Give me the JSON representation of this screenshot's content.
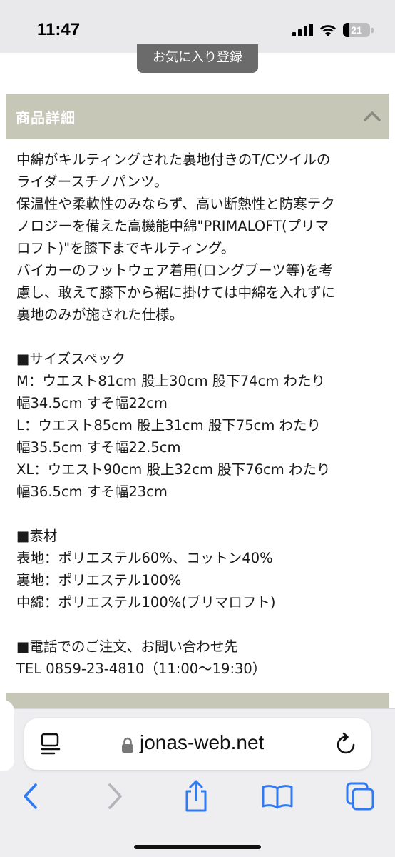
{
  "status": {
    "time": "11:47",
    "battery": "21",
    "icons": [
      "cellular-signal-icon",
      "wifi-icon",
      "battery-icon"
    ]
  },
  "favorite_button_label": "お気に入り登録",
  "section": {
    "title": "商品詳細",
    "icon": "chevron-up-icon"
  },
  "description": [
    "中綿がキルティングされた裏地付きのT/Cツイルの",
    "ライダースチノパンツ。",
    "保温性や柔軟性のみならず、高い断熱性と防寒テク",
    "ノロジーを備えた高機能中綿\"PRIMALOFT(プリマ",
    "ロフト)\"を膝下までキルティング。",
    "バイカーのフットウェア着用(ロングブーツ等)を考",
    "慮し、敢えて膝下から裾に掛けては中綿を入れずに",
    "裏地のみが施された仕様。"
  ],
  "size_spec": {
    "heading": "■サイズスペック",
    "lines": [
      "M：ウエスト81cm 股上30cm 股下74cm わたり",
      "幅34.5cm すそ幅22cm",
      "L：ウエスト85cm 股上31cm 股下75cm わたり",
      "幅35.5cm すそ幅22.5cm",
      "XL：ウエスト90cm 股上32cm 股下76cm わたり",
      "幅36.5cm すそ幅23cm"
    ]
  },
  "material": {
    "heading": "■素材",
    "lines": [
      "表地：ポリエステル60%、コットン40%",
      "裏地：ポリエステル100%",
      "中綿：ポリエステル100%(プリマロフト)"
    ]
  },
  "contact": {
    "heading": "■電話でのご注文、お問い合わせ先",
    "line": "TEL 0859-23-4810（11:00〜19:30）"
  },
  "browser": {
    "url": "jonas-web.net",
    "icons": [
      "reader-icon",
      "lock-icon",
      "reload-icon",
      "back-icon",
      "forward-icon",
      "share-icon",
      "bookmarks-icon",
      "tabs-icon"
    ]
  }
}
